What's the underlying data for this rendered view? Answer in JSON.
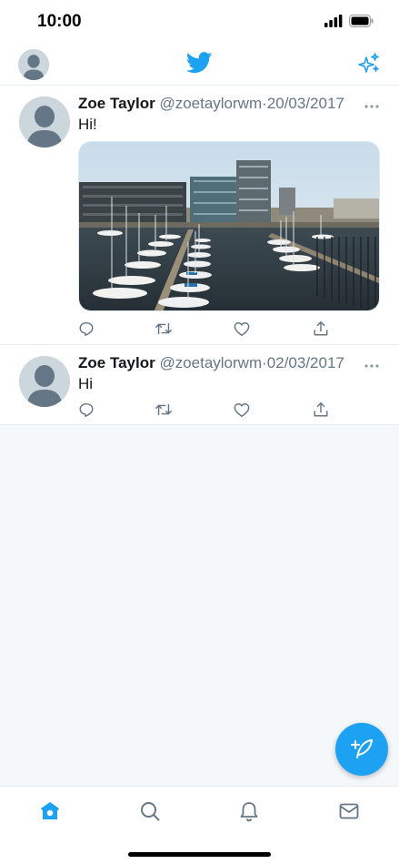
{
  "status_bar": {
    "time": "10:00"
  },
  "colors": {
    "accent": "#1da1f2",
    "text": "#14171a",
    "secondary_text": "#657786",
    "background": "#f5f8fa"
  },
  "top_nav": {
    "left_icon": "profile-avatar",
    "center_icon": "twitter-bird-icon",
    "right_icon": "sparkle-icon"
  },
  "feed": {
    "tweets": [
      {
        "name": "Zoe Taylor",
        "handle": "@zoetaylorwm",
        "separator": "·",
        "date": "20/03/2017",
        "text": "Hi!",
        "has_media": true
      },
      {
        "name": "Zoe Taylor",
        "handle": "@zoetaylorwm",
        "separator": "·",
        "date": "02/03/2017",
        "text": "Hi",
        "has_media": false
      }
    ]
  },
  "tweet_actions": [
    "reply-icon",
    "retweet-icon",
    "like-icon",
    "share-icon"
  ],
  "bottom_nav": {
    "active": "home",
    "tabs": [
      "home-icon",
      "search-icon",
      "notifications-icon",
      "messages-icon"
    ]
  },
  "fab": {
    "icon": "compose-tweet-icon"
  }
}
